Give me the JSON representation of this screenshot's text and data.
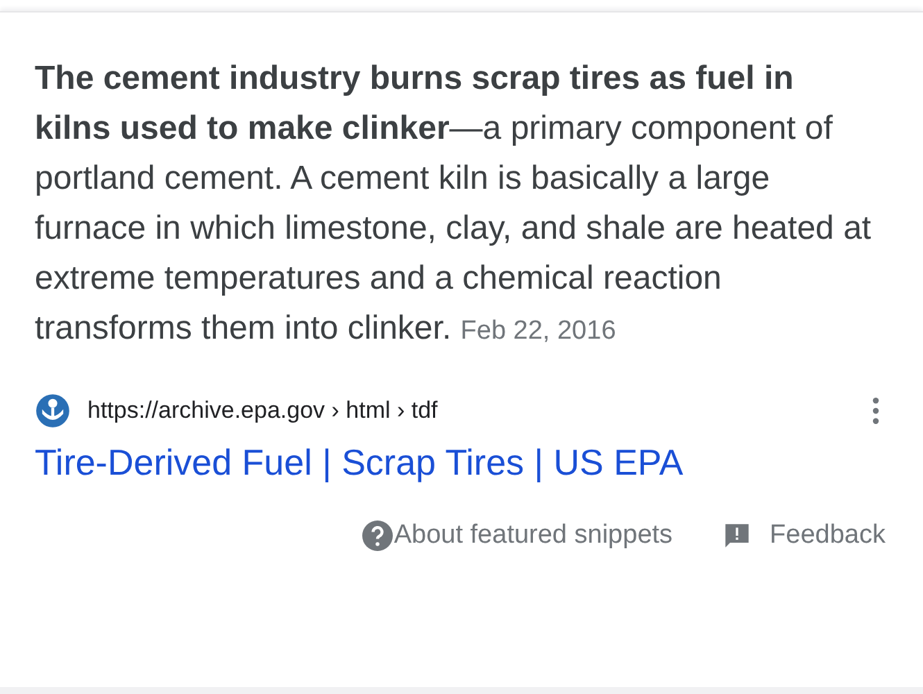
{
  "snippet": {
    "text": "**The cement industry burns scrap tires as fuel in kilns used to make clinker**—a primary component of portland cement. A cement kiln is basically a large furnace in which limestone, clay, and shale are heated at extreme temperatures and a chemical reaction transforms them into clinker.",
    "date": "Feb 22, 2016"
  },
  "source": {
    "url": "https://archive.epa.gov › html › tdf",
    "title": "Tire-Derived Fuel | Scrap Tires | US EPA"
  },
  "footer": {
    "about": "About featured snippets",
    "feedback": "Feedback"
  }
}
